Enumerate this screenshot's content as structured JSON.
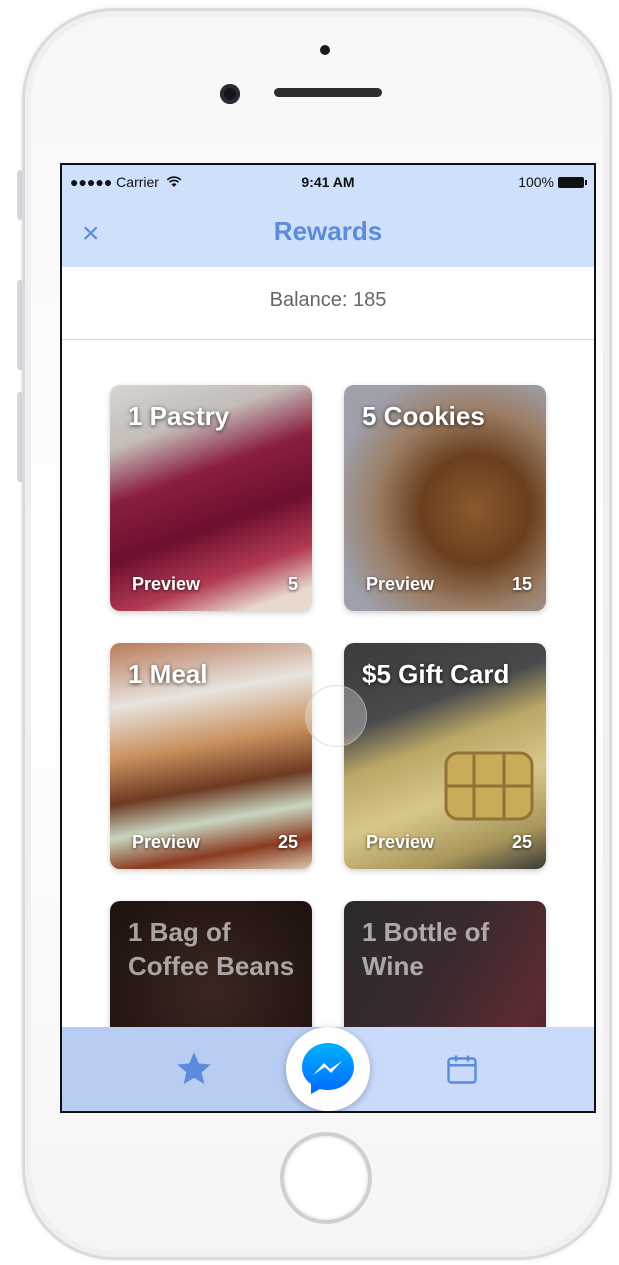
{
  "status_bar": {
    "carrier": "●●●●● Carrier",
    "time": "9:41 AM",
    "battery": "100%"
  },
  "nav": {
    "title": "Rewards",
    "close_icon": "×"
  },
  "balance": {
    "text": "Balance: 185"
  },
  "rewards": [
    {
      "title": "1 Pastry",
      "preview": "Preview",
      "cost": "5"
    },
    {
      "title": "5 Cookies",
      "preview": "Preview",
      "cost": "15"
    },
    {
      "title": "1 Meal",
      "preview": "Preview",
      "cost": "25"
    },
    {
      "title": "$5 Gift Card",
      "preview": "Preview",
      "cost": "25"
    },
    {
      "title": "1 Bag of Coffee Beans"
    },
    {
      "title": "1 Bottle of Wine"
    }
  ],
  "tab_bar": {
    "left_icon": "star-icon",
    "center_icon": "messenger-icon",
    "right_icon": "calendar-icon"
  },
  "colors": {
    "accent": "#5b8bd9",
    "nav_bg": "#cfe0fb",
    "tab_bg": "#c9dafa"
  }
}
